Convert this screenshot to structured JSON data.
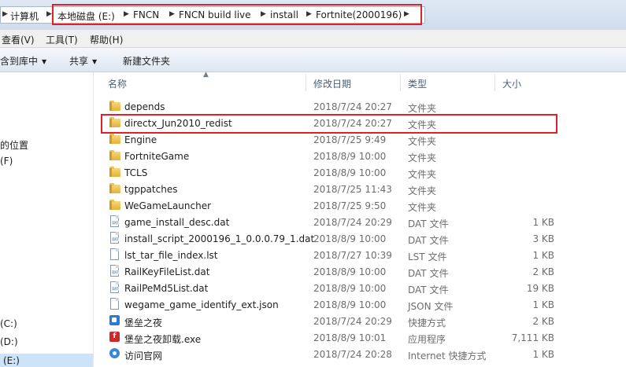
{
  "address": {
    "root": "计算机",
    "crumbs": [
      "本地磁盘 (E:)",
      "FNCN",
      "FNCN build live",
      "install",
      "Fortnite(2000196)"
    ]
  },
  "menu": [
    "查看(V)",
    "工具(T)",
    "帮助(H)"
  ],
  "toolbar": {
    "include_library": "含到库中",
    "share": "共享",
    "new_folder": "新建文件夹"
  },
  "nav": {
    "item_places": "的位置",
    "item_f": "(F)",
    "drive_c": "(C:)",
    "drive_d": "(D:)",
    "drive_e": "(E:)"
  },
  "columns": {
    "name": "名称",
    "date": "修改日期",
    "type": "类型",
    "size": "大小"
  },
  "files": [
    {
      "name": "depends",
      "date": "2018/7/24 20:27",
      "type": "文件夹",
      "size": "",
      "icon": "folder-icon"
    },
    {
      "name": "directx_Jun2010_redist",
      "date": "2018/7/24 20:27",
      "type": "文件夹",
      "size": "",
      "icon": "folder-icon"
    },
    {
      "name": "Engine",
      "date": "2018/7/25 9:49",
      "type": "文件夹",
      "size": "",
      "icon": "folder-icon"
    },
    {
      "name": "FortniteGame",
      "date": "2018/8/9 10:00",
      "type": "文件夹",
      "size": "",
      "icon": "folder-icon"
    },
    {
      "name": "TCLS",
      "date": "2018/8/9 10:00",
      "type": "文件夹",
      "size": "",
      "icon": "folder-icon"
    },
    {
      "name": "tgppatches",
      "date": "2018/7/25 11:43",
      "type": "文件夹",
      "size": "",
      "icon": "folder-icon"
    },
    {
      "name": "WeGameLauncher",
      "date": "2018/7/25 9:50",
      "type": "文件夹",
      "size": "",
      "icon": "folder-icon"
    },
    {
      "name": "game_install_desc.dat",
      "date": "2018/7/24 20:29",
      "type": "DAT 文件",
      "size": "1 KB",
      "icon": "dat-file-icon"
    },
    {
      "name": "install_script_2000196_1_0.0.0.79_1.dat",
      "date": "2018/8/9 10:00",
      "type": "DAT 文件",
      "size": "3 KB",
      "icon": "dat-file-icon"
    },
    {
      "name": "lst_tar_file_index.lst",
      "date": "2018/7/27 10:39",
      "type": "LST 文件",
      "size": "1 KB",
      "icon": "file-icon"
    },
    {
      "name": "RailKeyFileList.dat",
      "date": "2018/8/9 10:00",
      "type": "DAT 文件",
      "size": "2 KB",
      "icon": "dat-file-icon"
    },
    {
      "name": "RailPeMd5List.dat",
      "date": "2018/8/9 10:00",
      "type": "DAT 文件",
      "size": "19 KB",
      "icon": "dat-file-icon"
    },
    {
      "name": "wegame_game_identify_ext.json",
      "date": "2018/8/9 10:00",
      "type": "JSON 文件",
      "size": "1 KB",
      "icon": "file-icon"
    },
    {
      "name": "堡垒之夜",
      "date": "2018/7/24 20:29",
      "type": "快捷方式",
      "size": "2 KB",
      "icon": "shortcut-icon"
    },
    {
      "name": "堡垒之夜卸载.exe",
      "date": "2018/8/9 10:01",
      "type": "应用程序",
      "size": "7,111 KB",
      "icon": "exe-icon"
    },
    {
      "name": "访问官网",
      "date": "2018/7/24 20:28",
      "type": "Internet 快捷方式",
      "size": "1 KB",
      "icon": "internet-shortcut-icon"
    }
  ]
}
